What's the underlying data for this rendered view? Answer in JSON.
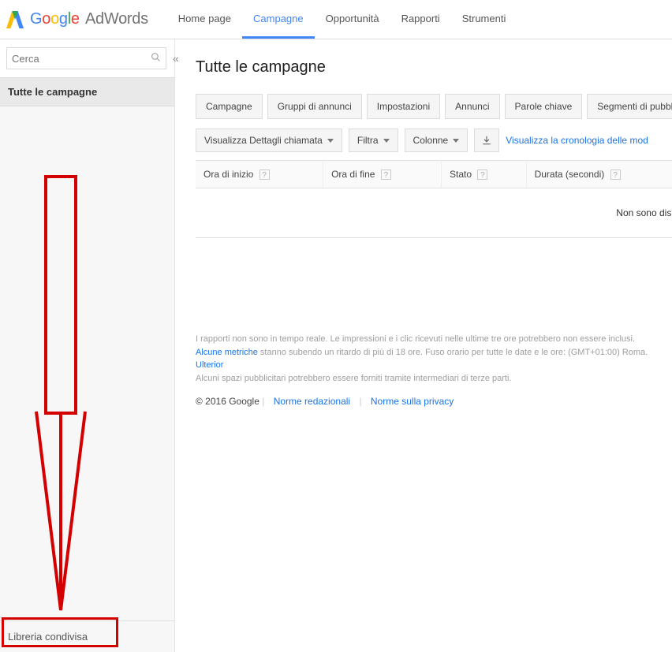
{
  "logo": {
    "product": "AdWords"
  },
  "top_nav": {
    "home": "Home page",
    "campaigns": "Campagne",
    "opportunities": "Opportunità",
    "reports": "Rapporti",
    "tools": "Strumenti"
  },
  "sidebar": {
    "search_placeholder": "Cerca",
    "all_campaigns": "Tutte le campagne",
    "shared_library": "Libreria condivisa"
  },
  "page": {
    "title": "Tutte le campagne"
  },
  "tabs": {
    "campaigns": "Campagne",
    "adgroups": "Gruppi di annunci",
    "settings": "Impostazioni",
    "ads": "Annunci",
    "keywords": "Parole chiave",
    "audiences": "Segmenti di pubblico"
  },
  "toolbar": {
    "view_call_details": "Visualizza Dettagli chiamata",
    "filter": "Filtra",
    "columns": "Colonne",
    "history_link": "Visualizza la cronologia delle mod"
  },
  "table": {
    "col_start": "Ora di inizio",
    "col_end": "Ora di fine",
    "col_state": "Stato",
    "col_duration": "Durata (secondi)",
    "empty_message": "Non sono disp"
  },
  "footnotes": {
    "line1": "I rapporti non sono in tempo reale. Le impressioni e i clic ricevuti nelle ultime tre ore potrebbero non essere inclusi.",
    "metrics_link": "Alcune metriche",
    "line2_rest": " stanno subendo un ritardo di più di 18 ore. Fuso orario per tutte le date e le ore: (GMT+01:00) Roma. ",
    "more_link": "Ulterior",
    "line3": "Alcuni spazi pubblicitari potrebbero essere forniti tramite intermediari di terze parti."
  },
  "footer": {
    "copyright": "© 2016 Google",
    "editorial": "Norme redazionali",
    "privacy": "Norme sulla privacy"
  }
}
